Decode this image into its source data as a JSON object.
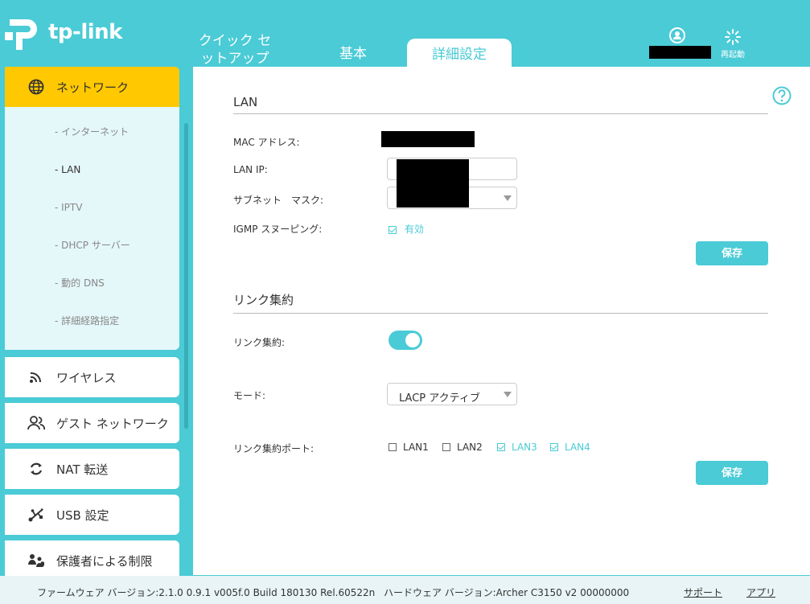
{
  "brand": {
    "logo_text": "tp-link",
    "accent": "#4acbd6",
    "highlight": "#ffc800"
  },
  "tabs": [
    {
      "label": "クイック セットアップ"
    },
    {
      "label": "基本"
    },
    {
      "label": "詳細設定"
    }
  ],
  "top": {
    "reboot_label": "再起動",
    "admin_icon": "admin-user-icon"
  },
  "sidebar": {
    "network": {
      "label": "ネットワーク",
      "icon": "globe-icon",
      "items": [
        {
          "label": "- インターネット"
        },
        {
          "label": "- LAN"
        },
        {
          "label": "- IPTV"
        },
        {
          "label": "- DHCP サーバー"
        },
        {
          "label": "- 動的 DNS"
        },
        {
          "label": "- 詳細経路指定"
        }
      ]
    },
    "groups": [
      {
        "label": "ワイヤレス",
        "icon": "wifi-icon"
      },
      {
        "label": "ゲスト ネットワーク",
        "icon": "guest-users-icon"
      },
      {
        "label": "NAT 転送",
        "icon": "nat-arrows-icon"
      },
      {
        "label": "USB 設定",
        "icon": "usb-icon"
      },
      {
        "label": "保護者による制限",
        "icon": "parental-icon"
      }
    ]
  },
  "lan": {
    "title": "LAN",
    "mac_label": "MAC アドレス:",
    "ip_label": "LAN IP:",
    "mask_label": "サブネット　マスク:",
    "igmp_label": "IGMP スヌーピング:",
    "igmp_value": "有効",
    "save_label": "保存"
  },
  "agg": {
    "title": "リンク集約",
    "toggle_label": "リンク集約:",
    "mode_label": "モード:",
    "mode_value": "LACP アクティブ",
    "ports_label": "リンク集約ポート:",
    "ports": [
      {
        "label": "LAN1",
        "checked": false
      },
      {
        "label": "LAN2",
        "checked": false
      },
      {
        "label": "LAN3",
        "checked": true
      },
      {
        "label": "LAN4",
        "checked": true
      }
    ],
    "save_label": "保存"
  },
  "footer": {
    "firmware": "ファームウェア バージョン:2.1.0 0.9.1 v005f.0 Build 180130 Rel.60522n",
    "hardware": "ハードウェア バージョン:Archer C3150 v2 00000000",
    "support": "サポート",
    "app": "アプリ"
  }
}
